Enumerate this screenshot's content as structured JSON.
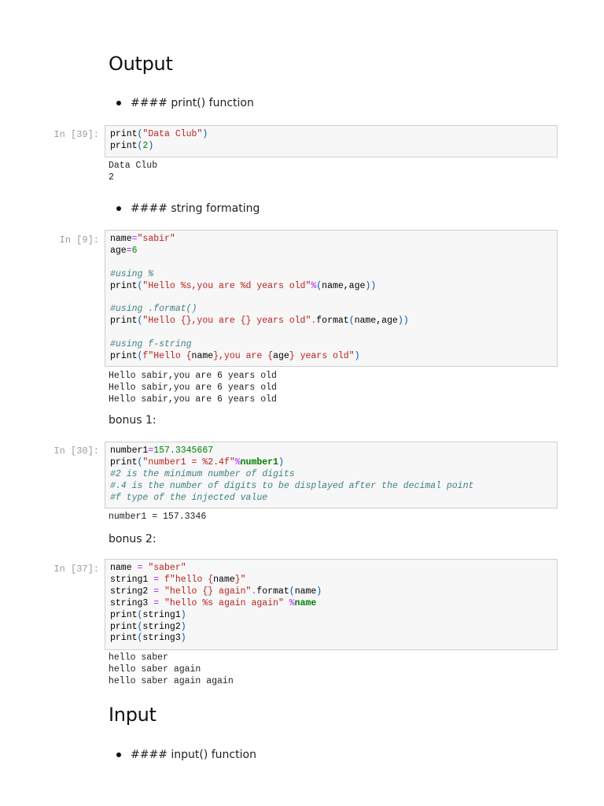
{
  "headings": {
    "output": "Output",
    "input": "Input"
  },
  "bullets": {
    "print_fn": "#### print() function",
    "string_fmt": "#### string formating",
    "input_fn": "#### input() function"
  },
  "markdown": {
    "bonus1": "bonus 1:",
    "bonus2": "bonus 2:"
  },
  "cells": [
    {
      "prompt": "In [39]:",
      "code": [
        [
          [
            "t",
            "print"
          ],
          [
            "p",
            "("
          ],
          [
            "s",
            "\"Data Club\""
          ],
          [
            "p",
            ")"
          ]
        ],
        [
          [
            "t",
            "print"
          ],
          [
            "p",
            "("
          ],
          [
            "n",
            "2"
          ],
          [
            "p",
            ")"
          ]
        ]
      ],
      "output": [
        "Data Club",
        "2"
      ]
    },
    {
      "prompt": "In [9]:",
      "code": [
        [
          [
            "t",
            "name"
          ],
          [
            "o",
            "="
          ],
          [
            "s",
            "\"sabir\""
          ]
        ],
        [
          [
            "t",
            "age"
          ],
          [
            "o",
            "="
          ],
          [
            "n",
            "6"
          ]
        ],
        [],
        [
          [
            "c",
            "#using %"
          ]
        ],
        [
          [
            "t",
            "print"
          ],
          [
            "p",
            "("
          ],
          [
            "s",
            "\"Hello %s,you are %d years old\""
          ],
          [
            "o",
            "%"
          ],
          [
            "p",
            "("
          ],
          [
            "t",
            "name,age"
          ],
          [
            "p",
            "))"
          ]
        ],
        [],
        [
          [
            "c",
            "#using .format()"
          ]
        ],
        [
          [
            "t",
            "print"
          ],
          [
            "p",
            "("
          ],
          [
            "s",
            "\"Hello {},you are {} years old\""
          ],
          [
            "o",
            "."
          ],
          [
            "t",
            "format"
          ],
          [
            "p",
            "("
          ],
          [
            "t",
            "name,age"
          ],
          [
            "p",
            "))"
          ]
        ],
        [],
        [
          [
            "c",
            "#using f-string"
          ]
        ],
        [
          [
            "t",
            "print"
          ],
          [
            "p",
            "("
          ],
          [
            "s",
            "f\"Hello {"
          ],
          [
            "t",
            "name"
          ],
          [
            "s",
            "},you are {"
          ],
          [
            "t",
            "age"
          ],
          [
            "s",
            "} years old\""
          ],
          [
            "p",
            ")"
          ]
        ]
      ],
      "output": [
        "Hello sabir,you are 6 years old",
        "Hello sabir,you are 6 years old",
        "Hello sabir,you are 6 years old"
      ]
    },
    {
      "prompt": "In [30]:",
      "code": [
        [
          [
            "t",
            "number1"
          ],
          [
            "o",
            "="
          ],
          [
            "n",
            "157.3345667"
          ]
        ],
        [
          [
            "t",
            "print"
          ],
          [
            "p",
            "("
          ],
          [
            "s",
            "\"number1 = %2.4f\""
          ],
          [
            "o",
            "%"
          ],
          [
            "k",
            "number1"
          ],
          [
            "p",
            ")"
          ]
        ],
        [
          [
            "c",
            "#2 is the minimum number of digits"
          ]
        ],
        [
          [
            "c",
            "#.4 is the number of digits to be displayed after the decimal point"
          ]
        ],
        [
          [
            "c",
            "#f type of the injected value"
          ]
        ]
      ],
      "output": [
        "number1 = 157.3346"
      ]
    },
    {
      "prompt": "In [37]:",
      "code": [
        [
          [
            "t",
            "name "
          ],
          [
            "o",
            "="
          ],
          [
            "t",
            " "
          ],
          [
            "s",
            "\"saber\""
          ]
        ],
        [
          [
            "t",
            "string1 "
          ],
          [
            "o",
            "="
          ],
          [
            "t",
            " "
          ],
          [
            "s",
            "f\"hello {"
          ],
          [
            "t",
            "name"
          ],
          [
            "s",
            "}\""
          ]
        ],
        [
          [
            "t",
            "string2 "
          ],
          [
            "o",
            "="
          ],
          [
            "t",
            " "
          ],
          [
            "s",
            "\"hello {} again\""
          ],
          [
            "o",
            "."
          ],
          [
            "t",
            "format"
          ],
          [
            "p",
            "("
          ],
          [
            "t",
            "name"
          ],
          [
            "p",
            ")"
          ]
        ],
        [
          [
            "t",
            "string3 "
          ],
          [
            "o",
            "="
          ],
          [
            "t",
            " "
          ],
          [
            "s",
            "\"hello %s again again\""
          ],
          [
            "t",
            " "
          ],
          [
            "o",
            "%"
          ],
          [
            "k",
            "name"
          ]
        ],
        [
          [
            "t",
            "print"
          ],
          [
            "p",
            "("
          ],
          [
            "t",
            "string1"
          ],
          [
            "p",
            ")"
          ]
        ],
        [
          [
            "t",
            "print"
          ],
          [
            "p",
            "("
          ],
          [
            "t",
            "string2"
          ],
          [
            "p",
            ")"
          ]
        ],
        [
          [
            "t",
            "print"
          ],
          [
            "p",
            "("
          ],
          [
            "t",
            "string3"
          ],
          [
            "p",
            ")"
          ]
        ]
      ],
      "output": [
        "hello saber",
        "hello saber again",
        "hello saber again again"
      ]
    }
  ]
}
